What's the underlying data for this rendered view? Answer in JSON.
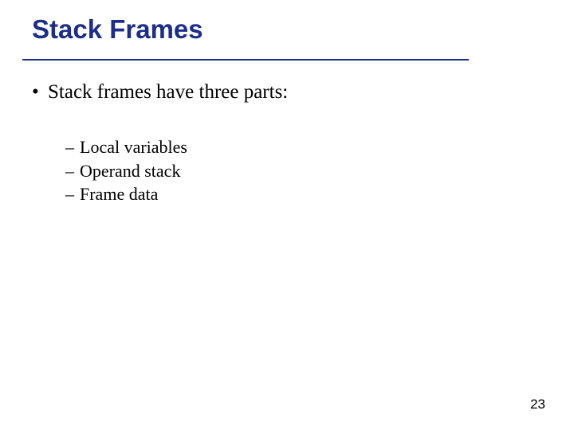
{
  "title": "Stack Frames",
  "bullets": {
    "main": "Stack frames have three parts:",
    "subs": [
      "Local variables",
      "Operand stack",
      "Frame data"
    ]
  },
  "page_number": "23"
}
